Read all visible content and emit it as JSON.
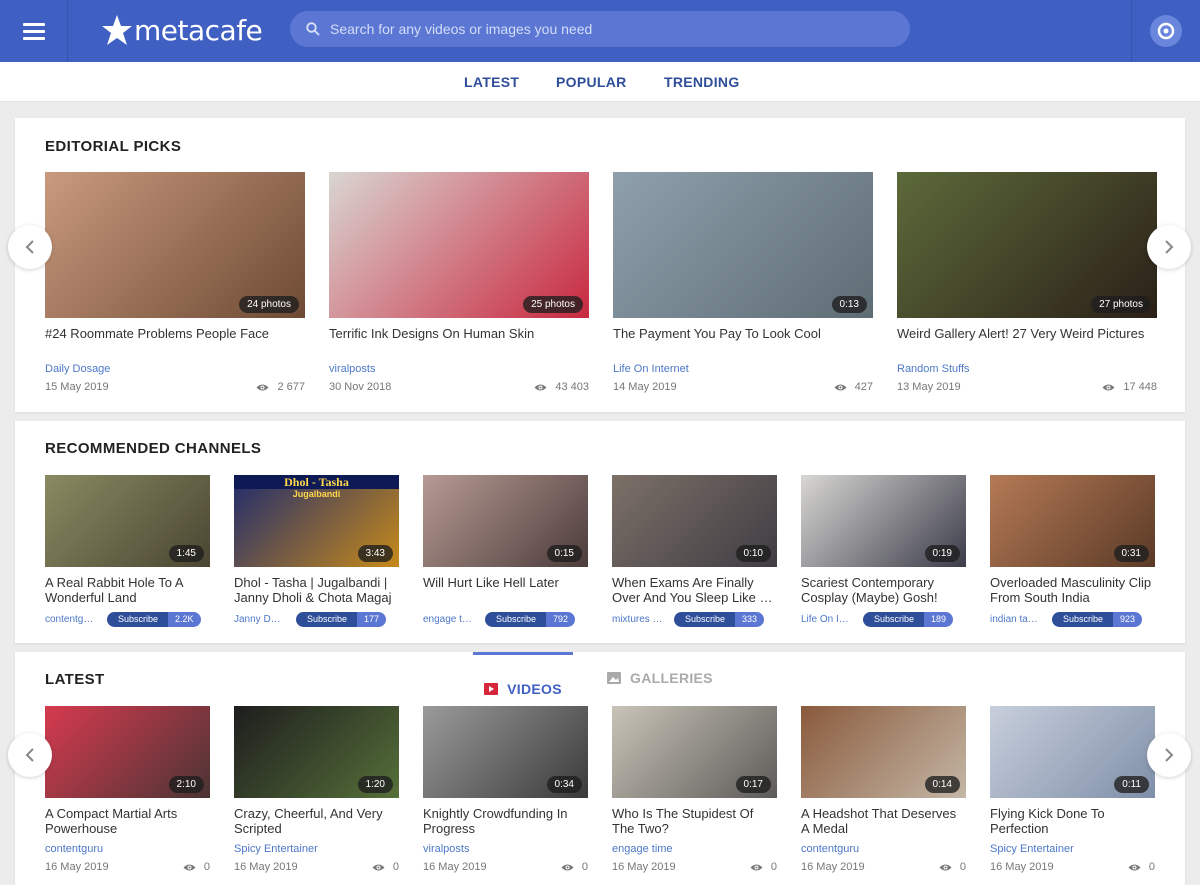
{
  "header": {
    "logo_text": "metacafe",
    "search_placeholder": "Search for any videos or images you need"
  },
  "nav": {
    "tabs": [
      "LATEST",
      "POPULAR",
      "TRENDING"
    ]
  },
  "editorial": {
    "title": "EDITORIAL PICKS",
    "cards": [
      {
        "title": "#24 Roommate Problems People Face",
        "badge": "24 photos",
        "channel": "Daily Dosage",
        "date": "15 May 2019",
        "views": "2 677",
        "colors": [
          "#c99a7e",
          "#6e4a34"
        ]
      },
      {
        "title": "Terrific Ink Designs On Human Skin",
        "badge": "25 photos",
        "channel": "viralposts",
        "date": "30 Nov 2018",
        "views": "43 403",
        "colors": [
          "#d9d6d2",
          "#c8283f"
        ]
      },
      {
        "title": "The Payment You Pay To Look Cool",
        "badge": "0:13",
        "channel": "Life On Internet",
        "date": "14 May 2019",
        "views": "427",
        "colors": [
          "#8fa0ad",
          "#5e6c74"
        ]
      },
      {
        "title": "Weird Gallery Alert! 27 Very Weird Pictures",
        "badge": "27 photos",
        "channel": "Random Stuffs",
        "date": "13 May 2019",
        "views": "17 448",
        "colors": [
          "#5c6a3a",
          "#2b2018"
        ]
      }
    ]
  },
  "recommended": {
    "title": "RECOMMENDED CHANNELS",
    "subscribe_label": "Subscribe",
    "cards": [
      {
        "title": "A Real Rabbit Hole To A Wonderful Land",
        "badge": "1:45",
        "channel": "contentg…",
        "subs": "2.2K",
        "colors": [
          "#8a8a62",
          "#4a4632"
        ]
      },
      {
        "title": "Dhol - Tasha | Jugalbandi | Janny Dholi & Chota Magaj",
        "badge": "3:43",
        "channel": "Janny D…",
        "subs": "177",
        "colors": [
          "#1f2b6e",
          "#c78a1a"
        ],
        "overlay": "Dhol  -  Tasha",
        "overlay2": "Jugalbandi"
      },
      {
        "title": "Will Hurt Like Hell Later",
        "badge": "0:15",
        "channel": "engage t…",
        "subs": "792",
        "colors": [
          "#b79b94",
          "#4b3b3a"
        ]
      },
      {
        "title": "When Exams Are Finally Over And You Sleep Like …",
        "badge": "0:10",
        "channel": "mixtures …",
        "subs": "333",
        "colors": [
          "#7d7168",
          "#3f3c43"
        ]
      },
      {
        "title": "Scariest Contemporary Cosplay (Maybe) Gosh!",
        "badge": "0:19",
        "channel": "Life On I…",
        "subs": "189",
        "colors": [
          "#d8d7d3",
          "#3c3c4a"
        ]
      },
      {
        "title": "Overloaded Masculinity Clip From South India",
        "badge": "0:31",
        "channel": "indian ta…",
        "subs": "923",
        "colors": [
          "#b57a56",
          "#5a3a26"
        ]
      }
    ]
  },
  "latest": {
    "title": "LATEST",
    "tab_videos": "VIDEOS",
    "tab_galleries": "GALLERIES",
    "cards": [
      {
        "title": "A Compact Martial Arts Powerhouse",
        "badge": "2:10",
        "channel": "contentguru",
        "date": "16 May 2019",
        "views": "0",
        "colors": [
          "#d63a4f",
          "#4a3434"
        ]
      },
      {
        "title": "Crazy, Cheerful, And Very Scripted",
        "badge": "1:20",
        "channel": "Spicy Entertainer",
        "date": "16 May 2019",
        "views": "0",
        "colors": [
          "#1d1d1d",
          "#56703a"
        ]
      },
      {
        "title": "Knightly Crowdfunding In Progress",
        "badge": "0:34",
        "channel": "viralposts",
        "date": "16 May 2019",
        "views": "0",
        "colors": [
          "#9a9a9a",
          "#3a3a3a"
        ]
      },
      {
        "title": "Who Is The Stupidest Of The Two?",
        "badge": "0:17",
        "channel": "engage time",
        "date": "16 May 2019",
        "views": "0",
        "colors": [
          "#c9c4b8",
          "#5c5b58"
        ]
      },
      {
        "title": "A Headshot That Deserves A Medal",
        "badge": "0:14",
        "channel": "contentguru",
        "date": "16 May 2019",
        "views": "0",
        "colors": [
          "#8a5a3c",
          "#c4b7a6"
        ]
      },
      {
        "title": "Flying Kick Done To Perfection",
        "badge": "0:11",
        "channel": "Spicy Entertainer",
        "date": "16 May 2019",
        "views": "0",
        "colors": [
          "#c8cfdc",
          "#7f8fa8"
        ]
      }
    ]
  },
  "colors": {
    "brand": "#3f5fc3",
    "accent_red": "#d6263a",
    "link": "#4c78c8"
  }
}
